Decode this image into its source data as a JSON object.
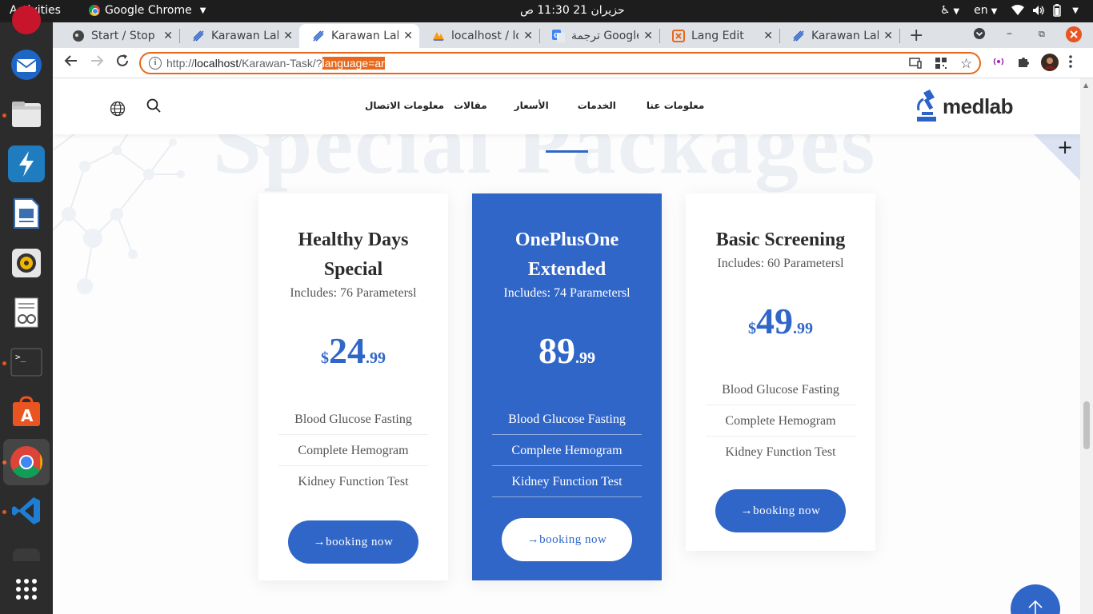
{
  "topbar": {
    "activities": "Activities",
    "app_name": "Google Chrome",
    "clock": "حزيران 21  11:30 ص",
    "lang": "en"
  },
  "tabs": [
    {
      "title": "Start / Stop a",
      "icon": "sloth-favicon-icon"
    },
    {
      "title": "Karawan Lab",
      "icon": "dna-favicon-icon"
    },
    {
      "title": "Karawan Lab",
      "icon": "dna-favicon-icon",
      "active": true
    },
    {
      "title": "localhost / lo",
      "icon": "phpmyadmin-favicon-icon"
    },
    {
      "title": "ترجمة Google",
      "icon": "google-translate-favicon-icon"
    },
    {
      "title": "Lang Edit",
      "icon": "lang-edit-favicon-icon"
    },
    {
      "title": "Karawan Lab",
      "icon": "dna-favicon-icon"
    }
  ],
  "omnibox": {
    "url_prefix": "http://",
    "url_host": "localhost",
    "url_path": "/Karawan-Task/?",
    "url_selected": "language=ar"
  },
  "site": {
    "logo_text": "medlab",
    "nav": [
      "معلومات عنا",
      "الخدمات",
      "الأسعار",
      "مقالات",
      "معلومات الاتصال"
    ],
    "ghost_title": "Special Packages"
  },
  "cards": [
    {
      "name_line1": "Healthy Days",
      "name_line2": "Special",
      "includes": "Includes: 76 Parametersl",
      "currency": "$",
      "price_int": "24",
      "price_dec": ".99",
      "features": [
        "Blood Glucose Fasting",
        "Complete Hemogram",
        "Kidney Function Test"
      ],
      "button": "→booking now"
    },
    {
      "name_line1": "OnePlusOne",
      "name_line2": "Extended",
      "includes": "Includes: 74 Parametersl",
      "currency": "",
      "price_int": "89",
      "price_dec": ".99",
      "features": [
        "Blood Glucose Fasting",
        "Complete Hemogram",
        "Kidney Function Test"
      ],
      "button": "→booking now"
    },
    {
      "name_line1": "Basic Screening",
      "includes": "Includes: 60 Parametersl",
      "currency": "$",
      "price_int": "49",
      "price_dec": ".99",
      "features": [
        "Blood Glucose Fasting",
        "Complete Hemogram",
        "Kidney Function Test"
      ],
      "button": "→booking now"
    }
  ],
  "colors": {
    "accent": "#3066c8",
    "omnibox_highlight": "#e8681c",
    "dock_bg": "#2c2c2c",
    "topbar_bg": "#1d1d1d"
  }
}
